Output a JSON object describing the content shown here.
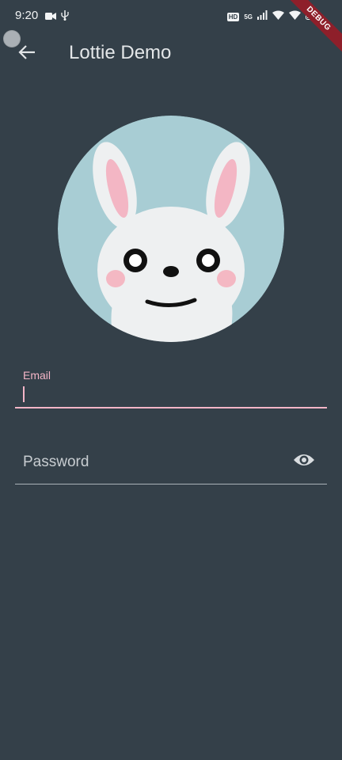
{
  "status_bar": {
    "time": "9:20",
    "hd_badge": "HD",
    "network": "5G"
  },
  "debug_banner": "DEBUG",
  "app_bar": {
    "title": "Lottie Demo"
  },
  "form": {
    "email": {
      "label": "Email",
      "value": ""
    },
    "password": {
      "placeholder": "Password"
    }
  },
  "colors": {
    "background": "#344049",
    "accent": "#f4b5c7",
    "avatar_bg": "#a8cdd4"
  }
}
